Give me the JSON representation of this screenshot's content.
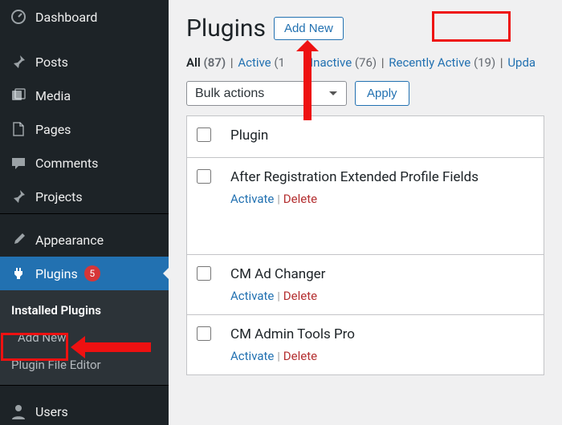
{
  "sidebar": {
    "items": [
      {
        "icon": "dashboard",
        "label": "Dashboard"
      },
      {
        "icon": "posts",
        "label": "Posts"
      },
      {
        "icon": "media",
        "label": "Media"
      },
      {
        "icon": "pages",
        "label": "Pages"
      },
      {
        "icon": "comments",
        "label": "Comments"
      },
      {
        "icon": "projects",
        "label": "Projects"
      },
      {
        "icon": "appearance",
        "label": "Appearance"
      },
      {
        "icon": "plugins",
        "label": "Plugins",
        "badge": "5",
        "active": true
      },
      {
        "icon": "users",
        "label": "Users"
      }
    ],
    "submenu": [
      {
        "label": "Installed Plugins",
        "current": true
      },
      {
        "label": "Add New"
      },
      {
        "label": "Plugin File Editor"
      }
    ]
  },
  "header": {
    "title": "Plugins",
    "add_new_label": "Add New"
  },
  "filters": {
    "all_label": "All",
    "all_count": "(87)",
    "active_label": "Active",
    "active_count": "(1",
    "inactive_label": "Inactive",
    "inactive_count": "(76)",
    "recent_label": "Recently Active",
    "recent_count": "(19)",
    "update_label": "Upda"
  },
  "bulk": {
    "placeholder": "Bulk actions",
    "apply_label": "Apply"
  },
  "table": {
    "col_plugin": "Plugin",
    "activate_label": "Activate",
    "delete_label": "Delete",
    "rows": [
      {
        "name": "After Registration Extended Profile Fields"
      },
      {
        "name": "CM Ad Changer"
      },
      {
        "name": "CM Admin Tools Pro"
      }
    ]
  }
}
